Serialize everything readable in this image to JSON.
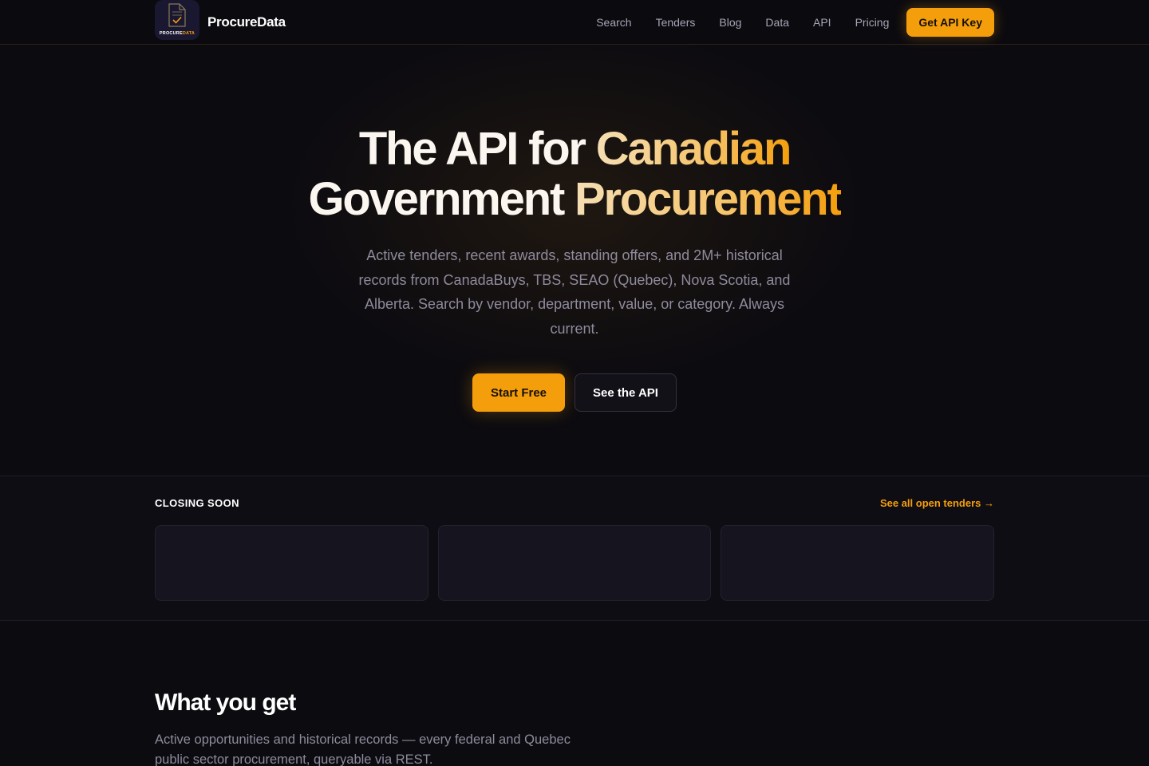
{
  "nav": {
    "brand_name": "ProcureData",
    "logo_text_white": "PROCURE",
    "logo_text_accent": "DATA",
    "links": [
      "Search",
      "Tenders",
      "Blog",
      "Data",
      "API",
      "Pricing"
    ],
    "cta_label": "Get API Key"
  },
  "hero": {
    "title_line1_white": "The API for ",
    "title_line1_accent": "Canadian",
    "title_line2_white": "Government ",
    "title_line2_accent": "Procurement",
    "subtitle": "Active tenders, recent awards, standing offers, and 2M+ historical records from CanadaBuys, TBS, SEAO (Quebec), Nova Scotia, and Alberta. Search by vendor, department, value, or category. Always current.",
    "primary_button": "Start Free",
    "secondary_button": "See the API"
  },
  "closing_soon": {
    "label": "CLOSING SOON",
    "link_label": "See all open tenders →"
  },
  "what_you_get": {
    "title": "What you get",
    "description": "Active opportunities and historical records — every federal and Quebec public sector procurement, queryable via REST."
  },
  "colors": {
    "accent": "#f59e0b",
    "background": "#0c0b10",
    "card_background": "#16151f"
  }
}
